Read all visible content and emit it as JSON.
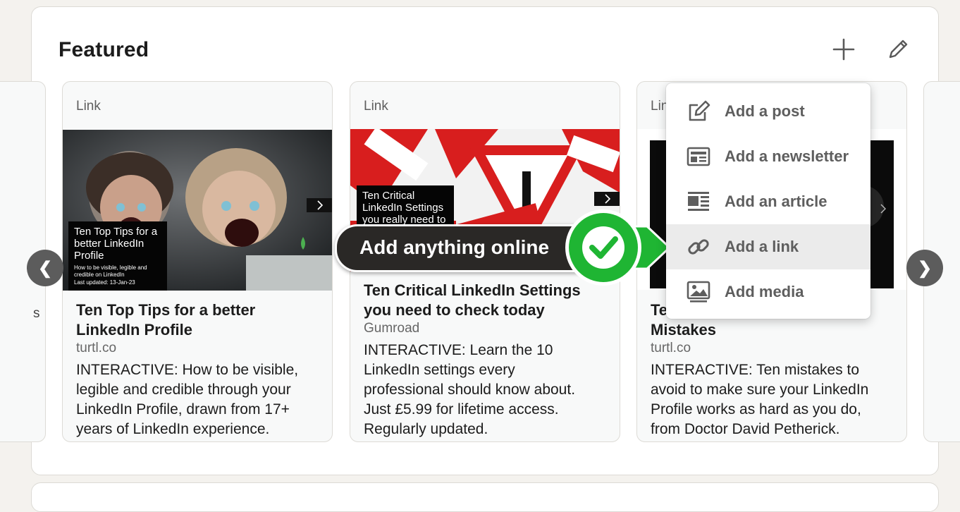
{
  "section": {
    "title": "Featured"
  },
  "cards": [
    {
      "type": "Link",
      "image_text": "Ten Top Tips for a better LinkedIn Profile",
      "image_subtext": "How to be visible, legible and credible on LinkedIn",
      "image_date": "Last updated: 13-Jan-23",
      "title_lines": [
        "Ten Top Tips for a better",
        "LinkedIn Profile"
      ],
      "source": "turtl.co",
      "desc_lines": [
        "INTERACTIVE: How to be visible,",
        "legible and credible through your",
        "LinkedIn Profile, drawn from 17+",
        "years of LinkedIn experience."
      ]
    },
    {
      "type": "Link",
      "image_text": "Ten Critical LinkedIn Settings you really need to",
      "title_lines": [
        "Ten Critical LinkedIn Settings",
        "you need to check today"
      ],
      "source": "Gumroad",
      "desc_lines": [
        "INTERACTIVE: Learn the 10",
        "LinkedIn settings every",
        "professional should know about.",
        "Just £5.99 for lifetime access.",
        "Regularly updated."
      ]
    },
    {
      "type": "Lin",
      "title_lines": [
        "Te",
        "Mistakes"
      ],
      "source": "turtl.co",
      "desc_lines": [
        "INTERACTIVE: Ten mistakes to",
        "avoid to make sure your LinkedIn",
        "Profile works as hard as you do,",
        "from Doctor David Petherick."
      ]
    }
  ],
  "partial_left_text": "s",
  "callout": {
    "text": "Add anything online"
  },
  "menu": {
    "items": [
      {
        "label": "Add a post",
        "icon": "edit-square-icon"
      },
      {
        "label": "Add a newsletter",
        "icon": "newsletter-icon"
      },
      {
        "label": "Add an article",
        "icon": "article-icon"
      },
      {
        "label": "Add a link",
        "icon": "link-icon"
      },
      {
        "label": "Add media",
        "icon": "media-icon"
      }
    ],
    "active_index": 3
  },
  "nav": {
    "prev": "❮",
    "next": "❯"
  },
  "colors": {
    "accent_green": "#1fb533",
    "callout_bg": "#2a2826",
    "page_bg": "#f4f2ee"
  }
}
